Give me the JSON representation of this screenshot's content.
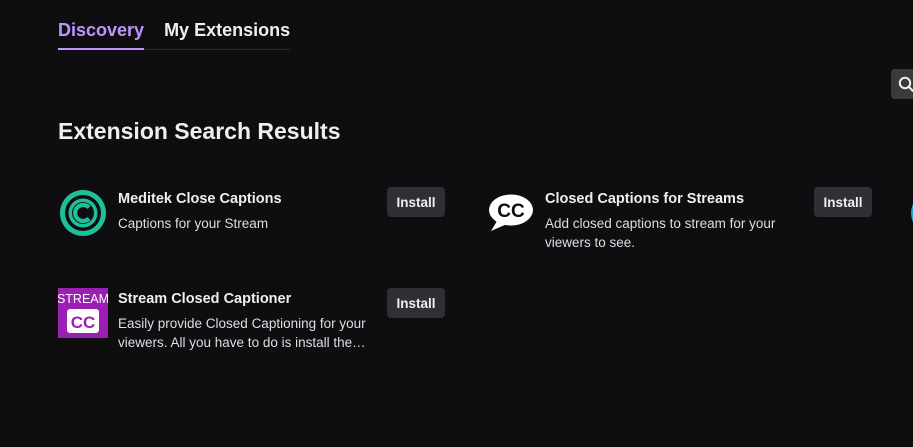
{
  "tabs": [
    {
      "label": "Discovery",
      "active": true
    },
    {
      "label": "My Extensions",
      "active": false
    }
  ],
  "search": {
    "icon": "search-icon"
  },
  "results": {
    "title": "Extension Search Results",
    "items": [
      {
        "name": "Meditek Close Captions",
        "description": "Captions for your Stream",
        "icon": "meditek-cc-logo",
        "install_label": "Install"
      },
      {
        "name": "Closed Captions for Streams",
        "description": "Add closed captions to stream for your viewers to see.",
        "icon": "cc-speech-bubble-logo",
        "install_label": "Install"
      },
      {
        "name": "Stream Closed Captioner",
        "description": "Easily provide Closed Captioning for your viewers. All you have to do is install the extension and start captioning.",
        "icon": "stream-cc-logo",
        "icon_text_top": "STREAM",
        "icon_text_bottom": "CC",
        "install_label": "Install"
      }
    ]
  },
  "colors": {
    "background": "#0e0e10",
    "accent": "#bf94ff",
    "button": "#2f2f35",
    "meditek_teal": "#1fbf9a",
    "stream_purple": "#9b1fb3"
  }
}
